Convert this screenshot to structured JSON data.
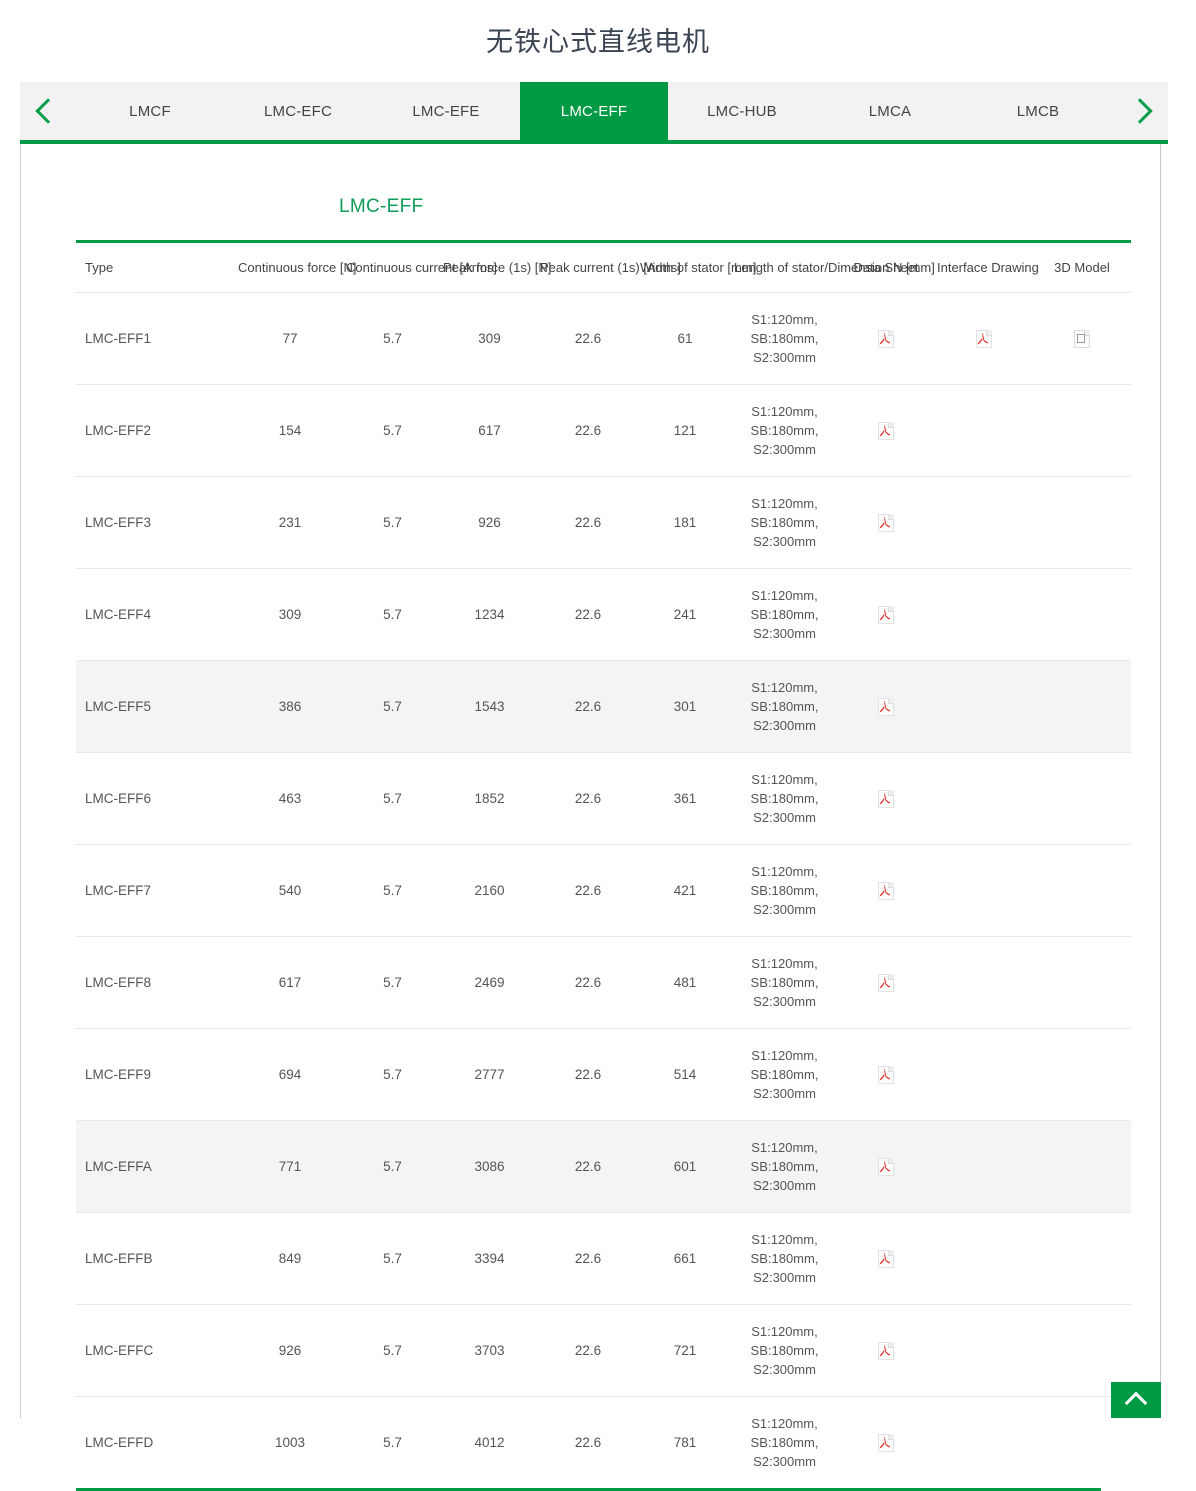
{
  "page": {
    "title": "无铁心式直线电机",
    "accent_green": "#009a44",
    "label_green": "#0f9d58"
  },
  "tabbar": {
    "prev_icon": "chevron-left-icon",
    "next_icon": "chevron-right-icon",
    "tabs": [
      {
        "label": "LMCF",
        "active": false
      },
      {
        "label": "LMC-EFC",
        "active": false
      },
      {
        "label": "LMC-EFE",
        "active": false
      },
      {
        "label": "LMC-EFF",
        "active": true
      },
      {
        "label": "LMC-HUB",
        "active": false
      },
      {
        "label": "LMCA",
        "active": false
      },
      {
        "label": "LMCB",
        "active": false
      }
    ]
  },
  "section": {
    "label": "LMC-EFF"
  },
  "table": {
    "headers": [
      "Type",
      "Continuous force [N]",
      "Continuous current [Arms]",
      "Peak force (1s) [N]",
      "Peak current (1s) [Arms]",
      "Width of stator [mm]",
      "Length of stator/Dimension N [mm]",
      "Data Sheet",
      "Interface Drawing",
      "3D Model"
    ],
    "rows": [
      {
        "type": "LMC-EFF1",
        "cont_force": "77",
        "cont_current": "5.7",
        "peak_force": "309",
        "peak_current": "22.6",
        "width": "61",
        "length": [
          "S1:120mm,",
          "SB:180mm,",
          "S2:300mm"
        ],
        "data_sheet": "pdf-icon",
        "interface_drawing": "pdf-icon",
        "model_3d": "cad-icon",
        "highlight": false
      },
      {
        "type": "LMC-EFF2",
        "cont_force": "154",
        "cont_current": "5.7",
        "peak_force": "617",
        "peak_current": "22.6",
        "width": "121",
        "length": [
          "S1:120mm,",
          "SB:180mm,",
          "S2:300mm"
        ],
        "data_sheet": "pdf-icon",
        "interface_drawing": "",
        "model_3d": "",
        "highlight": false
      },
      {
        "type": "LMC-EFF3",
        "cont_force": "231",
        "cont_current": "5.7",
        "peak_force": "926",
        "peak_current": "22.6",
        "width": "181",
        "length": [
          "S1:120mm,",
          "SB:180mm,",
          "S2:300mm"
        ],
        "data_sheet": "pdf-icon",
        "interface_drawing": "",
        "model_3d": "",
        "highlight": false
      },
      {
        "type": "LMC-EFF4",
        "cont_force": "309",
        "cont_current": "5.7",
        "peak_force": "1234",
        "peak_current": "22.6",
        "width": "241",
        "length": [
          "S1:120mm,",
          "SB:180mm,",
          "S2:300mm"
        ],
        "data_sheet": "pdf-icon",
        "interface_drawing": "",
        "model_3d": "",
        "highlight": false
      },
      {
        "type": "LMC-EFF5",
        "cont_force": "386",
        "cont_current": "5.7",
        "peak_force": "1543",
        "peak_current": "22.6",
        "width": "301",
        "length": [
          "S1:120mm,",
          "SB:180mm,",
          "S2:300mm"
        ],
        "data_sheet": "pdf-icon",
        "interface_drawing": "",
        "model_3d": "",
        "highlight": true
      },
      {
        "type": "LMC-EFF6",
        "cont_force": "463",
        "cont_current": "5.7",
        "peak_force": "1852",
        "peak_current": "22.6",
        "width": "361",
        "length": [
          "S1:120mm,",
          "SB:180mm,",
          "S2:300mm"
        ],
        "data_sheet": "pdf-icon",
        "interface_drawing": "",
        "model_3d": "",
        "highlight": false
      },
      {
        "type": "LMC-EFF7",
        "cont_force": "540",
        "cont_current": "5.7",
        "peak_force": "2160",
        "peak_current": "22.6",
        "width": "421",
        "length": [
          "S1:120mm,",
          "SB:180mm,",
          "S2:300mm"
        ],
        "data_sheet": "pdf-icon",
        "interface_drawing": "",
        "model_3d": "",
        "highlight": false
      },
      {
        "type": "LMC-EFF8",
        "cont_force": "617",
        "cont_current": "5.7",
        "peak_force": "2469",
        "peak_current": "22.6",
        "width": "481",
        "length": [
          "S1:120mm,",
          "SB:180mm,",
          "S2:300mm"
        ],
        "data_sheet": "pdf-icon",
        "interface_drawing": "",
        "model_3d": "",
        "highlight": false
      },
      {
        "type": "LMC-EFF9",
        "cont_force": "694",
        "cont_current": "5.7",
        "peak_force": "2777",
        "peak_current": "22.6",
        "width": "514",
        "length": [
          "S1:120mm,",
          "SB:180mm,",
          "S2:300mm"
        ],
        "data_sheet": "pdf-icon",
        "interface_drawing": "",
        "model_3d": "",
        "highlight": false
      },
      {
        "type": "LMC-EFFA",
        "cont_force": "771",
        "cont_current": "5.7",
        "peak_force": "3086",
        "peak_current": "22.6",
        "width": "601",
        "length": [
          "S1:120mm,",
          "SB:180mm,",
          "S2:300mm"
        ],
        "data_sheet": "pdf-icon",
        "interface_drawing": "",
        "model_3d": "",
        "highlight": true
      },
      {
        "type": "LMC-EFFB",
        "cont_force": "849",
        "cont_current": "5.7",
        "peak_force": "3394",
        "peak_current": "22.6",
        "width": "661",
        "length": [
          "S1:120mm,",
          "SB:180mm,",
          "S2:300mm"
        ],
        "data_sheet": "pdf-icon",
        "interface_drawing": "",
        "model_3d": "",
        "highlight": false
      },
      {
        "type": "LMC-EFFC",
        "cont_force": "926",
        "cont_current": "5.7",
        "peak_force": "3703",
        "peak_current": "22.6",
        "width": "721",
        "length": [
          "S1:120mm,",
          "SB:180mm,",
          "S2:300mm"
        ],
        "data_sheet": "pdf-icon",
        "interface_drawing": "",
        "model_3d": "",
        "highlight": false
      },
      {
        "type": "LMC-EFFD",
        "cont_force": "1003",
        "cont_current": "5.7",
        "peak_force": "4012",
        "peak_current": "22.6",
        "width": "781",
        "length": [
          "S1:120mm,",
          "SB:180mm,",
          "S2:300mm"
        ],
        "data_sheet": "pdf-icon",
        "interface_drawing": "",
        "model_3d": "",
        "highlight": false
      }
    ]
  },
  "back_to_top": {
    "icon": "chevron-up-icon"
  }
}
